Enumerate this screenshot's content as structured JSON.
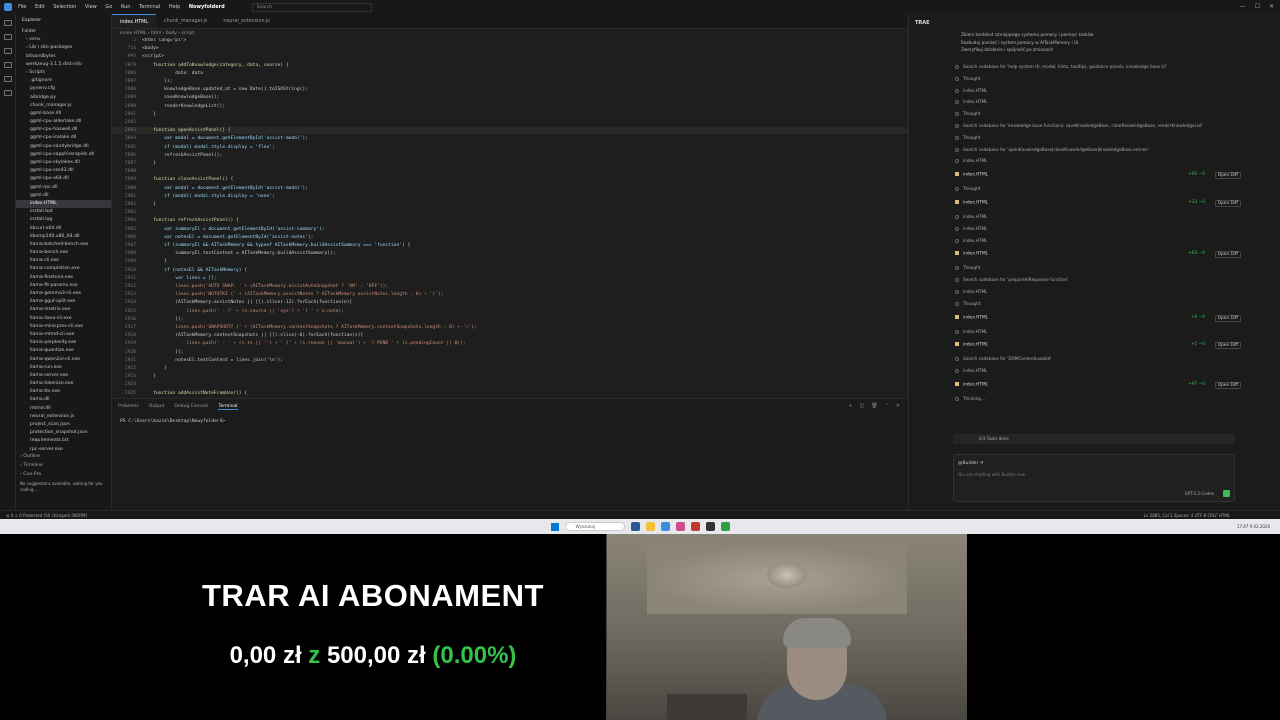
{
  "titlebar": {
    "menu": [
      "File",
      "Edit",
      "Selection",
      "View",
      "Go",
      "Run",
      "Terminal",
      "Help"
    ],
    "project": "Nowyfolderd",
    "search": "Search"
  },
  "explorer": {
    "header": "Explorer",
    "folder": "Folder",
    "items": [
      "› venv",
      "› Lib \\ site-packages",
      "bitsandbytes",
      "werkzeug-3.1.5.dist-info",
      "› Scripts",
      ".gitignore",
      "pyvenv.cfg",
      "aibridge.py",
      "chunk_manager.js",
      "ggml-base.dll",
      "ggml-cpu-alderlake.dll",
      "ggml-cpu-haswell.dll",
      "ggml-cpu-icelake.dll",
      "ggml-cpu-sandybridge.dll",
      "ggml-cpu-sapphirerapids.dll",
      "ggml-cpu-skylakex.dll",
      "ggml-cpu-sse42.dll",
      "ggml-cpu-x64.dll",
      "ggml-rpc.dll",
      "ggml.dll",
      "index.HTML",
      "install.bat",
      "install.log",
      "libcurl-x64.dll",
      "libomp140.x86_64.dll",
      "llama-batched-bench.exe",
      "llama-bench.exe",
      "llama-cli.exe",
      "llama-completion.exe",
      "llama-finetune.exe",
      "llama-fit-params.exe",
      "llama-gemma3-cli.exe",
      "llama-gguf-split.exe",
      "llama-imatrix.exe",
      "llama-llava-cli.exe",
      "llama-minicpmv-cli.exe",
      "llama-mtmd-cli.exe",
      "llama-perplexity.exe",
      "llama-quantize.exe",
      "llama-qwen2vl-cli.exe",
      "llama-run.exe",
      "llama-server.exe",
      "llama-tokenize.exe",
      "llama-tts.exe",
      "llama.dll",
      "mtmd.dll",
      "neural_extension.js",
      "project_scan.json",
      "protection_snapshot.json",
      "requirements.txt",
      "rpc-server.exe"
    ],
    "outline": "› Outline",
    "timeline": "› Timeline",
    "cue": "› Cue-Pro",
    "cue_text": "No suggestions available, waiting for you coding..."
  },
  "tabs": [
    "index.HTML",
    "chunk_manager.js",
    "neural_extension.js"
  ],
  "breadcrumb": "index.HTML › html › body › script",
  "code": {
    "numbers": [
      "2",
      "714",
      "993",
      "2879",
      "2886",
      "2887",
      "2888",
      "2889",
      "2890",
      "2891",
      "2892",
      "2893",
      "2894",
      "2895",
      "2896",
      "2897",
      "2898",
      "2899",
      "2900",
      "2901",
      "2902",
      "2903",
      "2904",
      "2905",
      "2906",
      "2907",
      "2908",
      "2909",
      "2910",
      "2911",
      "2912",
      "2913",
      "2914",
      "2915",
      "2916",
      "2917",
      "2918",
      "2919",
      "2920",
      "2921",
      "2922",
      "2923",
      "2924",
      "2925"
    ],
    "lines": [
      "<html lang=\"pl\">",
      "<body>",
      "<script>",
      "    function addToKnowledge(category, data, source) {",
      "            date: data",
      "        });",
      "        knowledgeBase.updated_at = new Date().toISOString();",
      "        saveKnowledgeBase();",
      "        renderKnowledgeList();",
      "    }",
      "",
      "    function openAssistPanel() {",
      "        var modal = document.getElementById('assist-modal');",
      "        if (modal) modal.style.display = 'flex';",
      "        refreshAssistPanel();",
      "    }",
      "",
      "    function closeAssistPanel() {",
      "        var modal = document.getElementById('assist-modal');",
      "        if (modal) modal.style.display = 'none';",
      "    }",
      "",
      "    function refreshAssistPanel() {",
      "        var summaryEl = document.getElementById('assist-summary');",
      "        var notesEl = document.getElementById('assist-notes');",
      "        if (summaryEl && AITaskMemory && typeof AITaskMemory.buildAssistSummary === 'function') {",
      "            summaryEl.textContent = AITaskMemory.buildAssistSummary();",
      "        }",
      "        if (notesEl && AITaskMemory) {",
      "            var lines = [];",
      "            lines.push('AUTO SNAP: ' + (AITaskMemory.assistAutoSnapshot ? 'ON' : 'OFF'));",
      "            lines.push('NOTATKI (' + (AITaskMemory.assistNotes ? AITaskMemory.assistNotes.length : 0) + ')');",
      "            (AITaskMemory.assistNotes || []).slice(-12).forEach(function(n){",
      "                lines.push(' - [' + (n.source || 'sys') + '] ' + n.note);",
      "            });",
      "            lines.push('SNAPSHOTY (' + (AITaskMemory.contextSnapshots ? AITaskMemory.contextSnapshots.length : 0) + ')');",
      "            (AITaskMemory.contextSnapshots || []).slice(-6).forEach(function(s){",
      "                lines.push(' - ' + (s.ts || '') + ' [' + (s.reason || 'manual') + '] PEND ' + (s.pendingCount || 0));",
      "            });",
      "            notesEl.textContent = lines.join('\\n');",
      "        }",
      "    }",
      "",
      "    function addAssistNoteFromUser() {"
    ]
  },
  "panel": {
    "tabs": [
      "Problems",
      "Output",
      "Debug Console",
      "Terminal"
    ],
    "prompt": "PS C:\\Users\\kazik\\Desktop\\Nowyfolder4>"
  },
  "trae": {
    "title": "TRAE",
    "task_lines": [
      "Zbierz kontekst istniejącego systemu pomocy i pamięci tasków",
      "Rozbuduj pamięć i system pomocy w AITaskMemory i UI",
      "Zweryfikuj działanie i spójność po zmianach"
    ],
    "events": [
      {
        "kind": "row",
        "text": "Search codebase for 'help system UI, modal, hints, tooltips, guidance panels, knowledge base UI'"
      },
      {
        "kind": "row",
        "text": "Thought"
      },
      {
        "kind": "row",
        "text": "index.HTML"
      },
      {
        "kind": "row",
        "text": "index.HTML"
      },
      {
        "kind": "row",
        "text": "Thought"
      },
      {
        "kind": "row",
        "text": "Search codebase for 'knowledge base functions: saveKnowledgeBase, clearKnowledgeBase, renderKnowledgeList'"
      },
      {
        "kind": "row",
        "text": "Thought"
      },
      {
        "kind": "row",
        "text": "Search codebase for 'openKnowledgeBase|closeKnowledgeBase|knowledgeBase.entries'"
      },
      {
        "kind": "row",
        "text": "index.HTML"
      },
      {
        "kind": "file",
        "text": "index.HTML",
        "stat": "+92 −0",
        "od": "Open Diff"
      },
      {
        "kind": "row",
        "text": "Thought"
      },
      {
        "kind": "file",
        "text": "index.HTML",
        "stat": "+23 −0",
        "od": "Open Diff"
      },
      {
        "kind": "row",
        "text": "index.HTML"
      },
      {
        "kind": "row",
        "text": "index.HTML"
      },
      {
        "kind": "row",
        "text": "index.HTML"
      },
      {
        "kind": "file",
        "text": "index.HTML",
        "stat": "+63 −0",
        "od": "Open Diff"
      },
      {
        "kind": "row",
        "text": "Thought"
      },
      {
        "kind": "row",
        "text": "Search codebase for 'prepareAIResponse function'"
      },
      {
        "kind": "row",
        "text": "index.HTML"
      },
      {
        "kind": "row",
        "text": "Thought"
      },
      {
        "kind": "file",
        "text": "index.HTML",
        "stat": "+9 −0",
        "od": "Open Diff"
      },
      {
        "kind": "row",
        "text": "index.HTML"
      },
      {
        "kind": "file",
        "text": "index.HTML",
        "stat": "+1 −0",
        "od": "Open Diff"
      },
      {
        "kind": "row",
        "text": "Search codebase for 'DOMContentLoaded'"
      },
      {
        "kind": "row",
        "text": "index.HTML"
      },
      {
        "kind": "file",
        "text": "index.HTML",
        "stat": "+97 −0",
        "od": "Open Diff"
      },
      {
        "kind": "row",
        "text": "Thinking..."
      }
    ],
    "tasks_done": "0/3 Tasks done",
    "chat_header": "@Builder ✕",
    "chat_placeholder": "You are chatting with Builder now",
    "model": "GPT-5.2-Codex"
  },
  "statusbar": {
    "left": "⊗ 0 ⚠ 0   Protected (50 changed) [NORM]",
    "right": "Ln 2885, Col 1   Spaces: 4   UTF-8   CRLF   HTML"
  },
  "taskbar": {
    "search": "Wyszukaj",
    "time": "17:47",
    "date": "9.02.2026"
  },
  "overlay": {
    "title": "TRAR AI ABONAMENT",
    "amount": "0,00 zł",
    "z": "z",
    "goal": "500,00 zł",
    "percent": "(0.00%)"
  },
  "colors": {
    "accent": "#3c8dde",
    "green": "#35c24b"
  }
}
